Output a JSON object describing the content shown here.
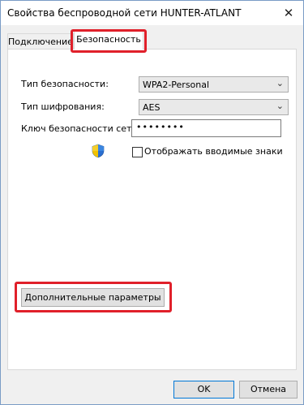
{
  "window": {
    "title": "Свойства беспроводной сети HUNTER-ATLANT",
    "close_glyph": "✕"
  },
  "tabs": [
    {
      "label": "Подключение",
      "active": false
    },
    {
      "label": "Безопасность",
      "active": true
    }
  ],
  "security": {
    "type_label": "Тип безопасности:",
    "type_value": "WPA2-Personal",
    "encryption_label": "Тип шифрования:",
    "encryption_value": "AES",
    "key_label": "Ключ безопасности сети",
    "key_value": "••••••••",
    "show_chars_label": "Отображать вводимые знаки",
    "show_chars_checked": false,
    "shield_icon": "uac-shield-icon"
  },
  "buttons": {
    "advanced": "Дополнительные параметры",
    "ok": "OK",
    "cancel": "Отмена"
  },
  "colors": {
    "highlight": "#e0202a",
    "accent": "#0078d7"
  }
}
